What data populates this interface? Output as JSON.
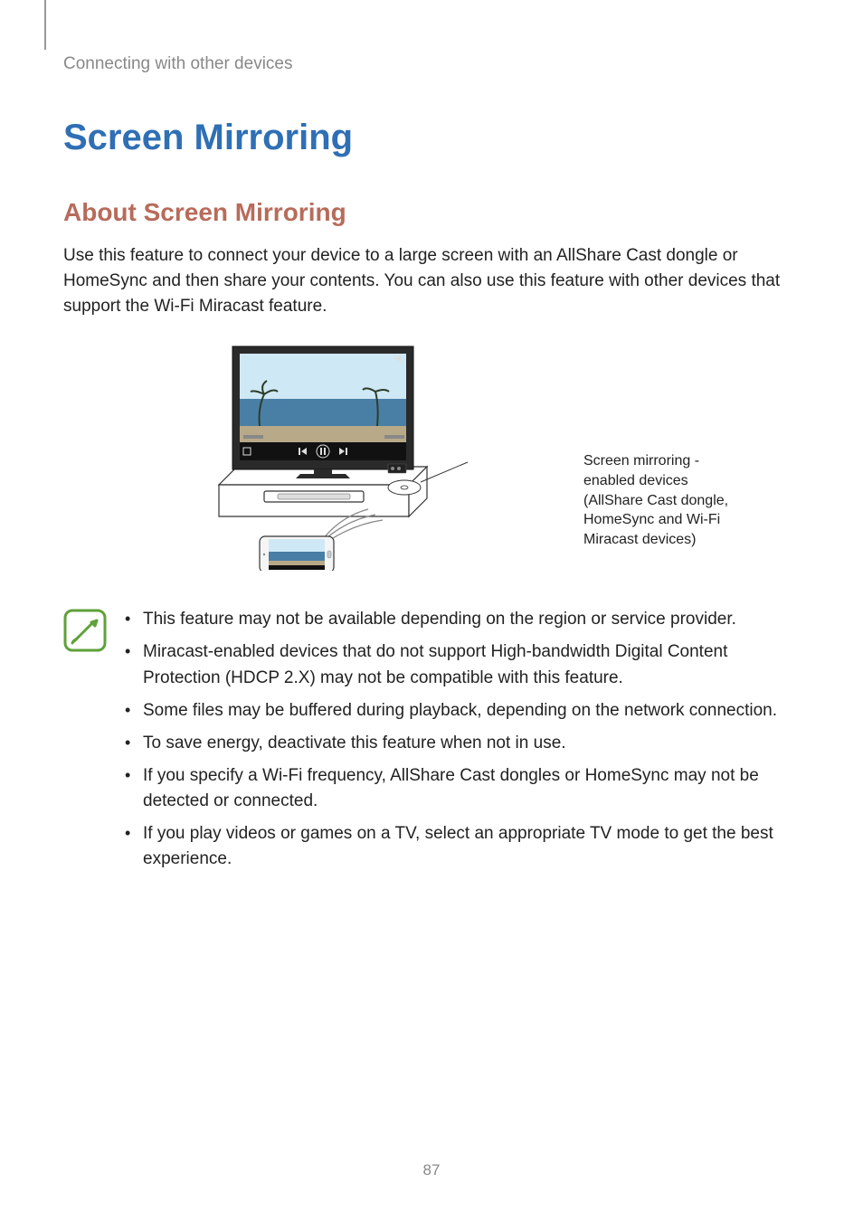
{
  "header": {
    "running_head": "Connecting with other devices"
  },
  "title": "Screen Mirroring",
  "subtitle": "About Screen Mirroring",
  "intro": "Use this feature to connect your device to a large screen with an AllShare Cast dongle or HomeSync and then share your contents. You can also use this feature with other devices that support the Wi-Fi Miracast feature.",
  "figure": {
    "callout": "Screen mirroring -enabled devices (AllShare Cast dongle, HomeSync and Wi-Fi Miracast devices)"
  },
  "notes": {
    "items": [
      "This feature may not be available depending on the region or service provider.",
      "Miracast-enabled devices that do not support High-bandwidth Digital Content Protection (HDCP 2.X) may not be compatible with this feature.",
      "Some files may be buffered during playback, depending on the network connection.",
      "To save energy, deactivate this feature when not in use.",
      "If you specify a Wi-Fi frequency, AllShare Cast dongles or HomeSync may not be detected or connected.",
      "If you play videos or games on a TV, select an appropriate TV mode to get the best experience."
    ]
  },
  "page_number": "87"
}
